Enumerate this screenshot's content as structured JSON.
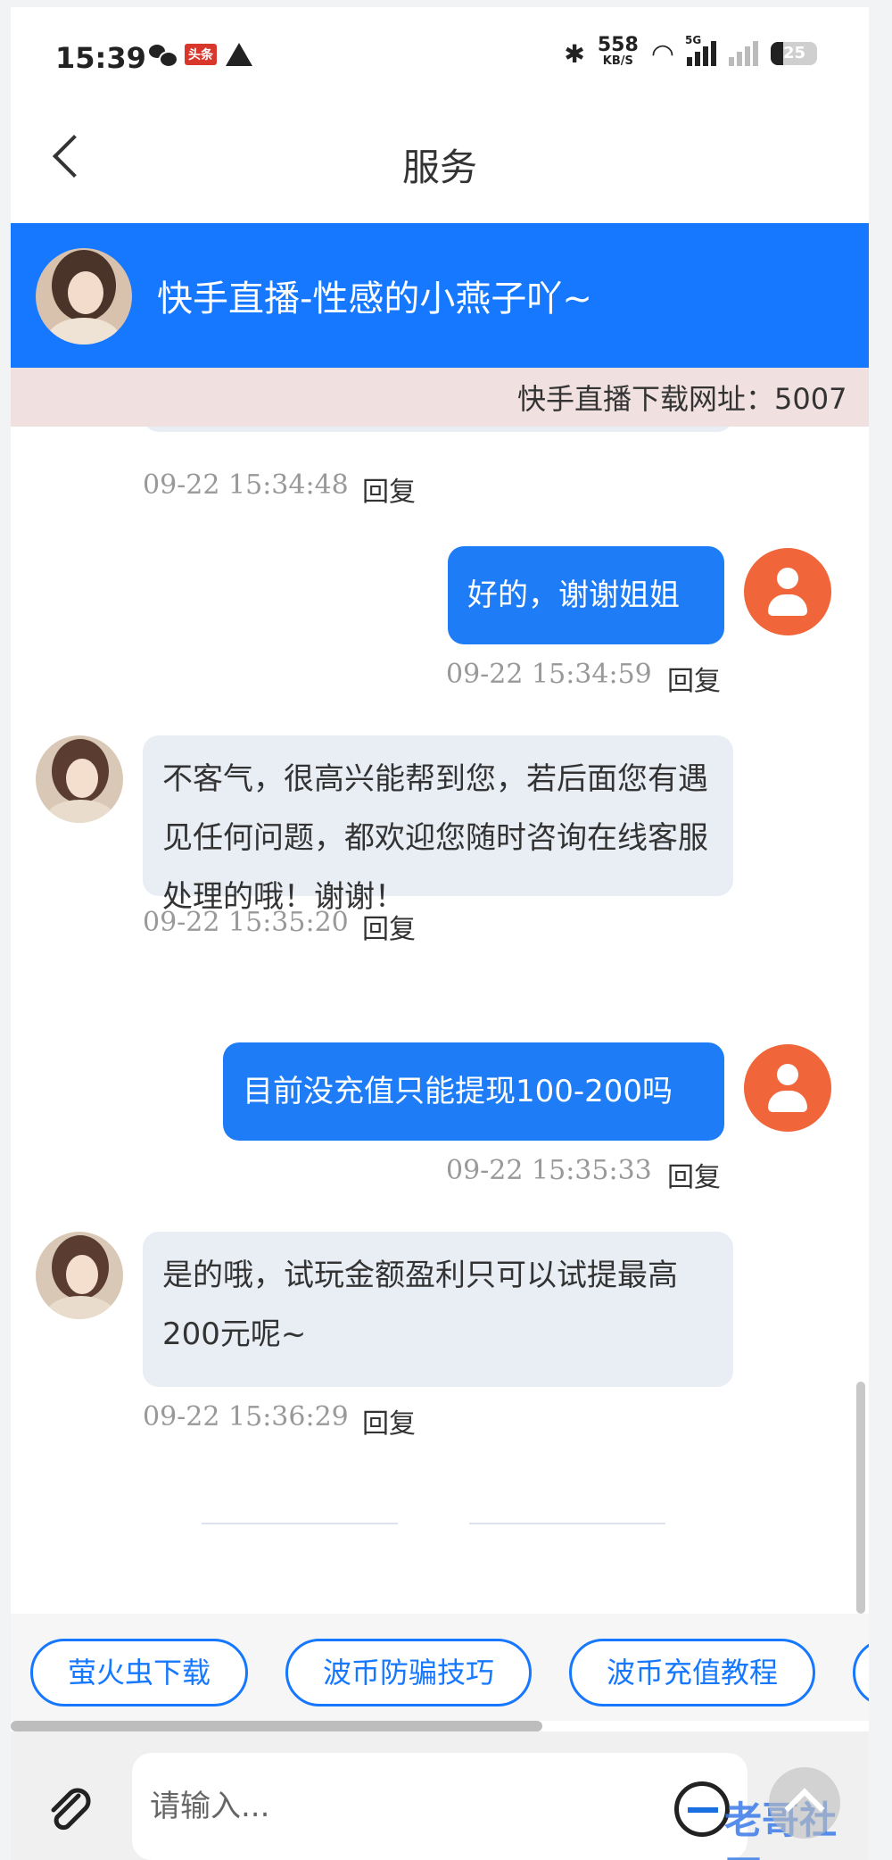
{
  "status_bar": {
    "time": "15:39",
    "toutiao_badge": "头条",
    "net_speed": "558",
    "net_speed_unit": "KB/S",
    "signal_label": "5G",
    "battery": "25"
  },
  "header": {
    "title": "服务"
  },
  "banner": {
    "name": "快手直播-性感的小燕子吖~"
  },
  "marquee": {
    "text": "快手直播下载网址：5007"
  },
  "messages": [
    {
      "from": "agent",
      "text": "",
      "time": "09-22 15:34:48",
      "reply": "回复"
    },
    {
      "from": "user",
      "text": "好的，谢谢姐姐",
      "time": "09-22 15:34:59",
      "reply": "回复"
    },
    {
      "from": "agent",
      "text": "不客气，很高兴能帮到您，若后面您有遇见任何问题，都欢迎您随时咨询在线客服处理的哦！谢谢！",
      "time": "09-22 15:35:20",
      "reply": "回复"
    },
    {
      "from": "user",
      "text": "目前没充值只能提现100-200吗",
      "time": "09-22 15:35:33",
      "reply": "回复"
    },
    {
      "from": "agent",
      "text": "是的哦，试玩金额盈利只可以试提最高200元呢~",
      "time": "09-22 15:36:29",
      "reply": "回复"
    }
  ],
  "quick_actions": [
    "萤火虫下载",
    "波币防骗技巧",
    "波币充值教程"
  ],
  "input": {
    "placeholder": "请输入..."
  },
  "watermark": "老哥社区",
  "colors": {
    "primary": "#1677ff",
    "user_bubble": "#1e7cf6",
    "agent_bubble": "#e9edf4",
    "user_avatar": "#f0663a"
  }
}
